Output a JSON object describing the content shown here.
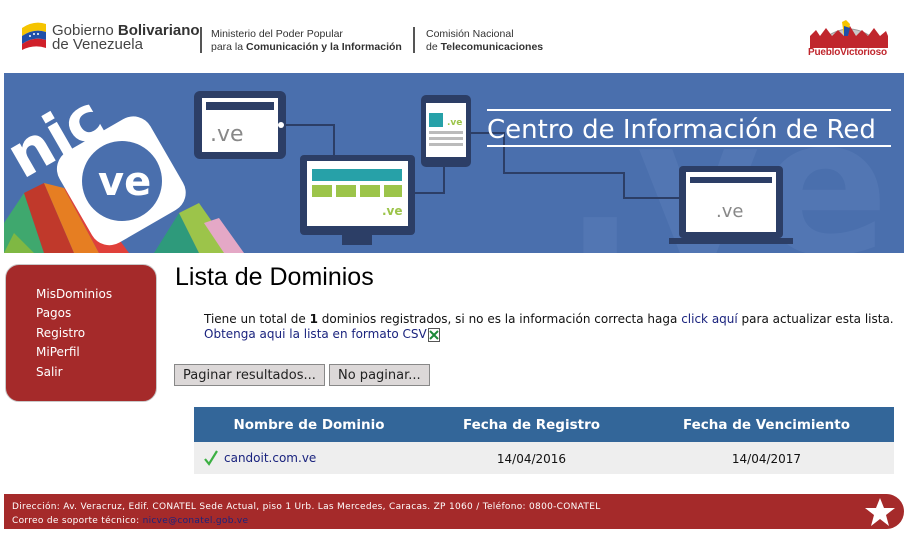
{
  "header": {
    "gov_line1_a": "Gobierno ",
    "gov_line1_b": "Bolivariano",
    "gov_line2": "de Venezuela",
    "ministry_line1": "Ministerio del Poder Popular",
    "ministry_line2_a": "para la ",
    "ministry_line2_b": "Comunicación y la Información",
    "conatel_line1": "Comisión Nacional",
    "conatel_line2_a": "de ",
    "conatel_line2_b": "Telecomunicaciones",
    "pv_logo_text": "PuebloVictorioso"
  },
  "banner": {
    "title": "Centro de Información de Red",
    "logo_text_nic": "nic",
    "logo_text_ve": "ve",
    "screen_text": ".ve"
  },
  "sidebar": {
    "items": [
      {
        "label": "MisDominios"
      },
      {
        "label": "Pagos"
      },
      {
        "label": "Registro"
      },
      {
        "label": "MiPerfil"
      },
      {
        "label": "Salir"
      }
    ]
  },
  "main": {
    "title": "Lista de Dominios",
    "info_prefix": "Tiene un total de ",
    "info_count": "1",
    "info_middle": " dominios registrados, si no es la información correcta haga ",
    "info_link": "click aquí",
    "info_suffix": " para actualizar esta lista.",
    "csv_link": "Obtenga aqui la lista en formato CSV",
    "btn_paginate": "Paginar resultados...",
    "btn_no_paginate": "No paginar..."
  },
  "table": {
    "headers": [
      "Nombre de Dominio",
      "Fecha de Registro",
      "Fecha de Vencimiento"
    ],
    "rows": [
      {
        "domain": "candoit.com.ve",
        "registered": "14/04/2016",
        "expires": "14/04/2017"
      }
    ]
  },
  "footer": {
    "address": "Dirección: Av. Veracruz, Edif. CONATEL Sede Actual, piso 1 Urb. Las Mercedes, Caracas. ZP 1060 / Teléfono: 0800-CONATEL",
    "support_label": "Correo de soporte técnico: ",
    "support_email": "nicve@conatel.gob.ve"
  },
  "colors": {
    "brand_red": "#a52a2a",
    "banner_blue": "#4a6fad",
    "table_header": "#336699",
    "link": "#1a237e"
  }
}
